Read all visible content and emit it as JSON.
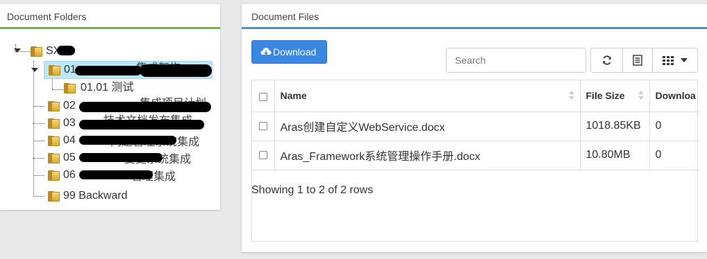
{
  "left_panel": {
    "title": "Document Folders",
    "tree": {
      "root_label": "SX",
      "selected_prefix": "01",
      "selected_suffix": "集成架构",
      "child_01_01": "01.01 测试",
      "items": [
        {
          "prefix": "02",
          "suffix": "集成项目计划"
        },
        {
          "prefix": "03",
          "suffix": "技术文档发布集成"
        },
        {
          "prefix": "04",
          "suffix": "问题管理系统集成"
        },
        {
          "prefix": "05",
          "suffix": "变更系统集成"
        },
        {
          "prefix": "06",
          "suffix": "管理集成"
        }
      ],
      "last_item": "99 Backward"
    }
  },
  "right_panel": {
    "title": "Document Files",
    "download_label": "Download",
    "search_placeholder": "Search",
    "table": {
      "columns": [
        "Name",
        "File Size",
        "Downloa"
      ],
      "rows": [
        {
          "name": "Aras创建自定义WebService.docx",
          "size": "1018.85KB",
          "downloads": "0"
        },
        {
          "name": "Aras_Framework系统管理操作手册.docx",
          "size": "10.80MB",
          "downloads": "0"
        }
      ]
    },
    "pagination_info": "Showing 1 to 2 of 2 rows"
  },
  "colors": {
    "left_accent": "#6fb83f",
    "right_accent": "#3d95d8",
    "download_button": "#3b86e0",
    "selected_row": "#bde7f6"
  },
  "icons": [
    "folder-icon",
    "cloud-download-icon",
    "refresh-icon",
    "list-icon",
    "columns-grid-icon",
    "caret-down-icon",
    "sort-icon"
  ]
}
